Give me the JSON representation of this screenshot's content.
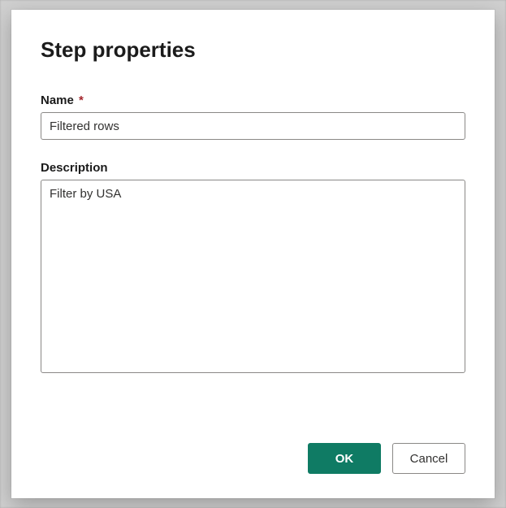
{
  "dialog": {
    "title": "Step properties",
    "name_label": "Name",
    "required_mark": "*",
    "name_value": "Filtered rows",
    "description_label": "Description",
    "description_value": "Filter by USA",
    "buttons": {
      "ok": "OK",
      "cancel": "Cancel"
    }
  }
}
